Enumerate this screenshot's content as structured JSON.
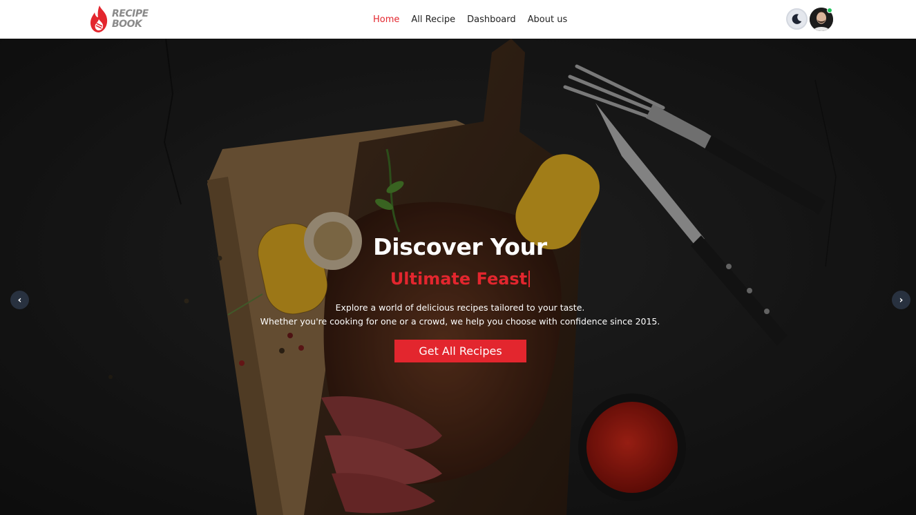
{
  "brand": {
    "name_line1": "RECIPE",
    "name_line2": "BOOK",
    "accent_color": "#e3262e"
  },
  "nav": {
    "items": [
      {
        "label": "Home",
        "active": true
      },
      {
        "label": "All Recipe",
        "active": false
      },
      {
        "label": "Dashboard",
        "active": false
      },
      {
        "label": "About us",
        "active": false
      }
    ]
  },
  "header_actions": {
    "theme_toggle_icon": "moon-icon",
    "avatar_icon": "user-avatar",
    "status": "online"
  },
  "hero": {
    "title": "Discover Your",
    "highlight": "Ultimate Feast",
    "description_line1": "Explore a world of delicious recipes tailored to your taste.",
    "description_line2": "Whether you're cooking for one or a crowd, we help you choose with confidence since 2015.",
    "cta_label": "Get All Recipes",
    "prev_icon": "chevron-left-icon",
    "next_icon": "chevron-right-icon",
    "prev_glyph": "‹",
    "next_glyph": "›"
  }
}
